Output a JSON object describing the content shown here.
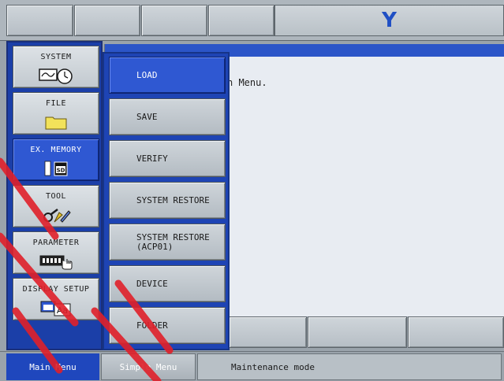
{
  "topbar": {
    "logo_letter": "Y",
    "brand_color": "#1f4fc4"
  },
  "main_menu": {
    "items": [
      {
        "label": "SYSTEM",
        "icon": "system-clock-icon"
      },
      {
        "label": "FILE",
        "icon": "folder-icon"
      },
      {
        "label": "EX. MEMORY",
        "icon": "sd-card-icon",
        "active": true
      },
      {
        "label": "TOOL",
        "icon": "tools-icon"
      },
      {
        "label": "PARAMETER",
        "icon": "parameter-icon"
      },
      {
        "label": "DISPLAY SETUP",
        "icon": "display-setup-icon"
      }
    ]
  },
  "content": {
    "message": "n Menu."
  },
  "submenu": {
    "items": [
      {
        "label": "LOAD",
        "active": true
      },
      {
        "label": "SAVE"
      },
      {
        "label": "VERIFY"
      },
      {
        "label": "SYSTEM RESTORE"
      },
      {
        "label": "SYSTEM RESTORE\n(ACP01)"
      },
      {
        "label": "DEVICE"
      },
      {
        "label": "FOLDER"
      }
    ]
  },
  "status": {
    "main_menu_label": "Main Menu",
    "simple_menu_label": "Simple Menu",
    "mode_text": "Maintenance mode"
  },
  "colors": {
    "accent_blue": "#2f58d2",
    "panel_blue": "#1b3fa8",
    "watermark_red": "#e0202a"
  }
}
